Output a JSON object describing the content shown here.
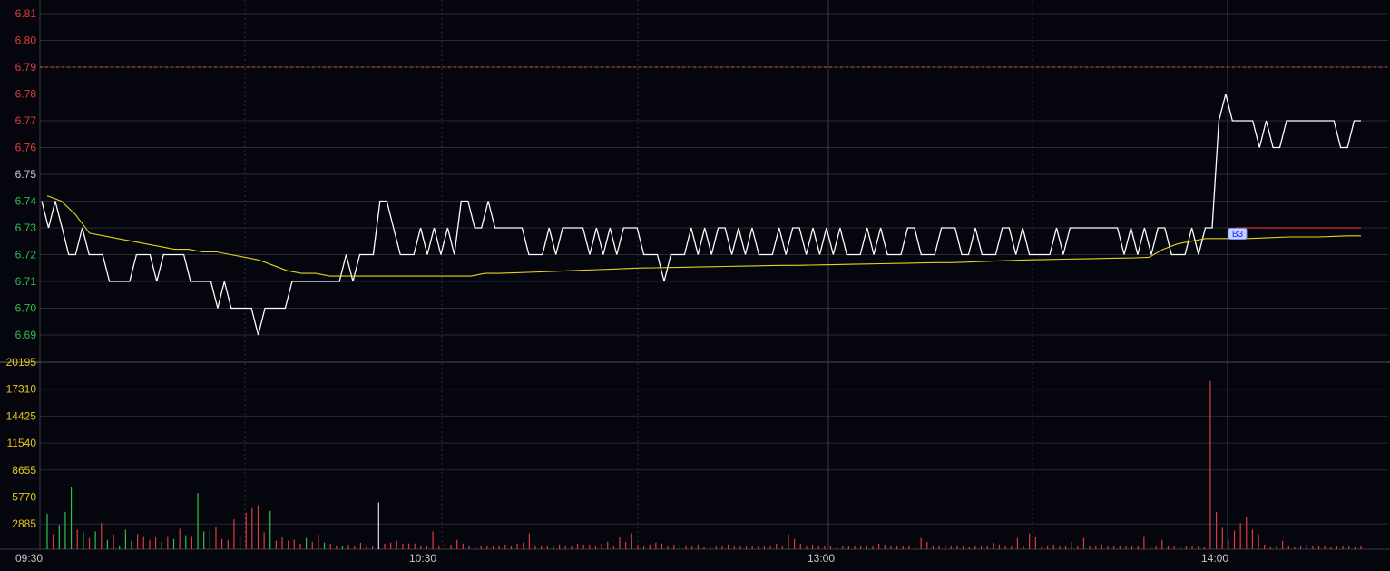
{
  "chart_data": [
    {
      "type": "line",
      "panel": "price",
      "y_ticks": [
        6.81,
        6.8,
        6.79,
        6.78,
        6.77,
        6.76,
        6.75,
        6.74,
        6.73,
        6.72,
        6.71,
        6.7,
        6.69
      ],
      "y_tick_labels": [
        "6.81",
        "6.80",
        "6.79",
        "6.78",
        "6.77",
        "6.76",
        "6.75",
        "6.74",
        "6.73",
        "6.72",
        "6.71",
        "6.70",
        "6.69"
      ],
      "ylim": [
        6.68,
        6.81
      ],
      "reference_price": 6.75,
      "prev_close_dashed": 6.79,
      "x_ticks": [
        "09:30",
        "10:30",
        "13:00",
        "14:00"
      ],
      "grid": true,
      "series": [
        {
          "key": "price",
          "color": "#ffffff",
          "values": [
            6.74,
            6.73,
            6.74,
            6.73,
            6.72,
            6.72,
            6.73,
            6.72,
            6.72,
            6.72,
            6.71,
            6.71,
            6.71,
            6.71,
            6.72,
            6.72,
            6.72,
            6.71,
            6.72,
            6.72,
            6.72,
            6.72,
            6.71,
            6.71,
            6.71,
            6.71,
            6.7,
            6.71,
            6.7,
            6.7,
            6.7,
            6.7,
            6.69,
            6.7,
            6.7,
            6.7,
            6.7,
            6.71,
            6.71,
            6.71,
            6.71,
            6.71,
            6.71,
            6.71,
            6.71,
            6.72,
            6.71,
            6.72,
            6.72,
            6.72,
            6.74,
            6.74,
            6.73,
            6.72,
            6.72,
            6.72,
            6.73,
            6.72,
            6.73,
            6.72,
            6.73,
            6.72,
            6.74,
            6.74,
            6.73,
            6.73,
            6.74,
            6.73,
            6.73,
            6.73,
            6.73,
            6.73,
            6.72,
            6.72,
            6.72,
            6.73,
            6.72,
            6.73,
            6.73,
            6.73,
            6.73,
            6.72,
            6.73,
            6.72,
            6.73,
            6.72,
            6.73,
            6.73,
            6.73,
            6.72,
            6.72,
            6.72,
            6.71,
            6.72,
            6.72,
            6.72,
            6.73,
            6.72,
            6.73,
            6.72,
            6.73,
            6.73,
            6.72,
            6.73,
            6.72,
            6.73,
            6.72,
            6.72,
            6.72,
            6.73,
            6.72,
            6.73,
            6.73,
            6.72,
            6.73,
            6.72,
            6.73,
            6.72,
            6.73,
            6.72,
            6.72,
            6.72,
            6.73,
            6.72,
            6.73,
            6.72,
            6.72,
            6.72,
            6.73,
            6.73,
            6.72,
            6.72,
            6.72,
            6.73,
            6.73,
            6.73,
            6.72,
            6.72,
            6.73,
            6.72,
            6.72,
            6.72,
            6.73,
            6.73,
            6.72,
            6.73,
            6.72,
            6.72,
            6.72,
            6.72,
            6.73,
            6.72,
            6.73,
            6.73,
            6.73,
            6.73,
            6.73,
            6.73,
            6.73,
            6.73,
            6.72,
            6.73,
            6.72,
            6.73,
            6.72,
            6.73,
            6.73,
            6.72,
            6.72,
            6.72,
            6.73,
            6.72,
            6.73,
            6.73,
            6.77,
            6.78,
            6.77,
            6.77,
            6.77,
            6.77,
            6.76,
            6.77,
            6.76,
            6.76,
            6.77,
            6.77,
            6.77,
            6.77,
            6.77,
            6.77,
            6.77,
            6.77,
            6.76,
            6.76,
            6.77,
            6.77
          ]
        },
        {
          "key": "average",
          "color": "#e6d21e",
          "values": [
            6.742,
            6.74,
            6.735,
            6.728,
            6.727,
            6.726,
            6.725,
            6.724,
            6.723,
            6.722,
            6.722,
            6.721,
            6.721,
            6.72,
            6.719,
            6.718,
            6.716,
            6.714,
            6.713,
            6.713,
            6.712,
            6.712,
            6.712,
            6.712,
            6.712,
            6.712,
            6.712,
            6.712,
            6.712,
            6.712,
            6.712,
            6.713,
            6.713,
            6.7132,
            6.7134,
            6.7136,
            6.7138,
            6.714,
            6.7142,
            6.7144,
            6.7146,
            6.7148,
            6.715,
            6.7151,
            6.7152,
            6.7153,
            6.7154,
            6.7155,
            6.7156,
            6.7157,
            6.7158,
            6.7159,
            6.716,
            6.716,
            6.7161,
            6.7162,
            6.7163,
            6.7164,
            6.7165,
            6.7166,
            6.7167,
            6.7168,
            6.7169,
            6.717,
            6.717,
            6.7172,
            6.7174,
            6.7176,
            6.7178,
            6.718,
            6.7181,
            6.7182,
            6.7183,
            6.7184,
            6.7185,
            6.7186,
            6.7187,
            6.7188,
            6.719,
            6.722,
            6.724,
            6.725,
            6.726,
            6.726,
            6.726,
            6.726,
            6.7262,
            6.7264,
            6.7266,
            6.7266,
            6.7266,
            6.7268,
            6.727,
            6.727
          ]
        }
      ],
      "reference_line": {
        "value": 6.73,
        "color": "#d03030",
        "label": "B3"
      }
    },
    {
      "type": "bar",
      "panel": "volume",
      "y_ticks": [
        20195,
        17310,
        14425,
        11540,
        8655,
        5770,
        2885
      ],
      "y_tick_labels": [
        "20195",
        "17310",
        "14425",
        "11540",
        "8655",
        "5770",
        "2885"
      ],
      "ylim": [
        0,
        20195
      ],
      "colors": {
        "up": "#e03c3c",
        "down": "#2ec24a",
        "flat": "#e0e0e0"
      },
      "values": [
        3800,
        1600,
        2600,
        4000,
        6700,
        2100,
        1800,
        1200,
        1900,
        2800,
        1000,
        1600,
        400,
        2100,
        900,
        1600,
        1400,
        1000,
        1300,
        800,
        1400,
        1100,
        2200,
        1500,
        1400,
        6000,
        1900,
        2000,
        2400,
        1100,
        1000,
        3200,
        1400,
        3900,
        4400,
        4700,
        1800,
        4100,
        900,
        1300,
        900,
        1000,
        600,
        1200,
        800,
        1600,
        700,
        600,
        400,
        300,
        500,
        300,
        700,
        400,
        300,
        5000,
        600,
        700,
        900,
        600,
        600,
        600,
        400,
        300,
        1900,
        400,
        700,
        500,
        1000,
        600,
        300,
        400,
        300,
        400,
        300,
        400,
        500,
        300,
        600,
        700,
        1700,
        400,
        400,
        300,
        400,
        500,
        400,
        300,
        600,
        500,
        500,
        400,
        600,
        800,
        300,
        1300,
        800,
        1700,
        500,
        400,
        500,
        700,
        600,
        300,
        500,
        400,
        400,
        300,
        500,
        200,
        400,
        400,
        300,
        500,
        300,
        300,
        300,
        300,
        400,
        300,
        400,
        600,
        300,
        1600,
        1100,
        600,
        400,
        500,
        400,
        300,
        300,
        200,
        300,
        300,
        400,
        300,
        400,
        300,
        600,
        500,
        300,
        300,
        400,
        400,
        300,
        1200,
        800,
        400,
        300,
        500,
        400,
        300,
        300,
        200,
        400,
        300,
        300,
        700,
        500,
        300,
        400,
        1200,
        400,
        1700,
        1300,
        400,
        400,
        500,
        400,
        300,
        800,
        300,
        1200,
        400,
        300,
        500,
        300,
        300,
        400,
        300,
        300,
        300,
        1400,
        300,
        400,
        1000,
        400,
        300,
        300,
        400,
        300,
        300,
        200,
        18000,
        4000,
        2300,
        1000,
        2000,
        2800,
        3500,
        2100,
        1600,
        500,
        200,
        300,
        900,
        400,
        200,
        300,
        500,
        300,
        400,
        300,
        200,
        300,
        400,
        300,
        200,
        300
      ],
      "directions": [
        "down",
        "up",
        "down",
        "down",
        "down",
        "up",
        "down",
        "up",
        "down",
        "up",
        "down",
        "up",
        "down",
        "down",
        "down",
        "up",
        "up",
        "up",
        "up",
        "down",
        "up",
        "down",
        "up",
        "down",
        "up",
        "down",
        "down",
        "down",
        "up",
        "up",
        "up",
        "up",
        "down",
        "up",
        "up",
        "up",
        "up",
        "down",
        "up",
        "up",
        "up",
        "up",
        "up",
        "down",
        "up",
        "up",
        "down",
        "up",
        "up",
        "down",
        "up",
        "up",
        "up",
        "up",
        "up",
        "flat",
        "up",
        "up",
        "up",
        "up",
        "up",
        "up",
        "up",
        "up",
        "up",
        "up",
        "up",
        "up",
        "up",
        "up",
        "up",
        "up",
        "up",
        "up",
        "up",
        "up",
        "up",
        "up",
        "up",
        "up",
        "up",
        "up",
        "up",
        "up",
        "up",
        "up",
        "up",
        "up",
        "up",
        "up",
        "up",
        "up",
        "up",
        "up",
        "up",
        "up",
        "up",
        "up",
        "up",
        "up",
        "up",
        "up",
        "up",
        "up",
        "up",
        "up",
        "up",
        "up",
        "up",
        "up",
        "up",
        "up",
        "up",
        "up",
        "up",
        "up",
        "up",
        "up",
        "up",
        "up",
        "up",
        "up",
        "up",
        "up",
        "up",
        "up",
        "up",
        "up",
        "up",
        "up",
        "up",
        "up",
        "up",
        "up",
        "up",
        "up",
        "up",
        "up",
        "up",
        "up",
        "up",
        "up",
        "up",
        "up",
        "up",
        "up",
        "up",
        "up",
        "up",
        "up",
        "up",
        "up",
        "up",
        "up",
        "up",
        "up",
        "up",
        "up",
        "up",
        "up",
        "up",
        "up",
        "up",
        "up",
        "up",
        "up",
        "up",
        "up",
        "up",
        "up",
        "up",
        "up",
        "up",
        "up",
        "up",
        "up",
        "up",
        "up",
        "up",
        "up",
        "up",
        "up",
        "up",
        "up",
        "up",
        "up",
        "up",
        "up",
        "up",
        "up",
        "up",
        "up",
        "up",
        "up",
        "up",
        "up",
        "up",
        "up",
        "up",
        "up",
        "up",
        "up",
        "up",
        "up",
        "up",
        "up",
        "up",
        "up",
        "up",
        "up",
        "up",
        "up",
        "up",
        "up",
        "up",
        "up",
        "up",
        "up",
        "up",
        "up",
        "up",
        "up",
        "up",
        "up",
        "up",
        "up",
        "up",
        "up",
        "up",
        "up",
        "up",
        "up",
        "up",
        "up"
      ]
    }
  ]
}
